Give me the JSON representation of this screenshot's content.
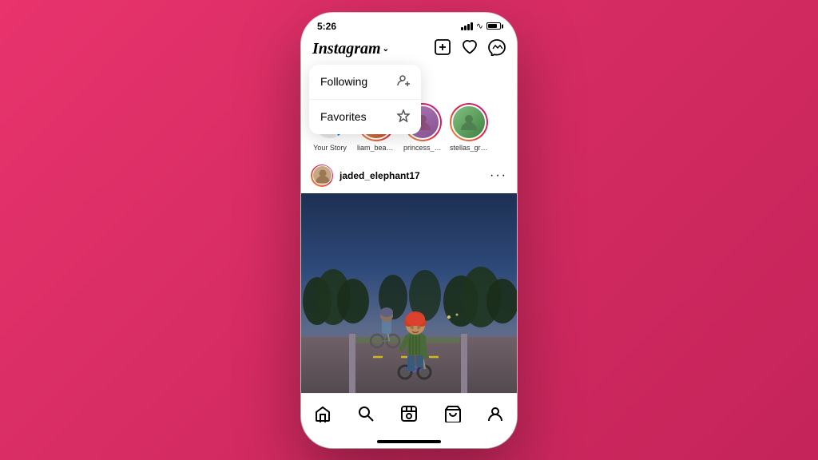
{
  "background_color": "#e0336a",
  "status_bar": {
    "time": "5:26"
  },
  "header": {
    "logo": "Instagram",
    "logo_arrow": "∨",
    "icons": {
      "add": "⊕",
      "heart": "♡",
      "messenger": "✉"
    }
  },
  "dropdown": {
    "items": [
      {
        "label": "Following",
        "icon": "person-add-icon"
      },
      {
        "label": "Favorites",
        "icon": "star-icon"
      }
    ]
  },
  "stories": [
    {
      "label": "Your Story",
      "type": "your-story"
    },
    {
      "label": "liam_bean...",
      "type": "gradient"
    },
    {
      "label": "princess_p...",
      "type": "gradient"
    },
    {
      "label": "stellas_gr0...",
      "type": "gradient"
    }
  ],
  "post": {
    "username": "jaded_elephant17",
    "more": "···"
  },
  "bottom_nav": {
    "items": [
      {
        "label": "home",
        "icon": "⌂",
        "active": true
      },
      {
        "label": "search",
        "icon": "⌕",
        "active": false
      },
      {
        "label": "reels",
        "icon": "▷",
        "active": false
      },
      {
        "label": "shop",
        "icon": "⊡",
        "active": false
      },
      {
        "label": "profile",
        "icon": "◯",
        "active": false
      }
    ]
  }
}
